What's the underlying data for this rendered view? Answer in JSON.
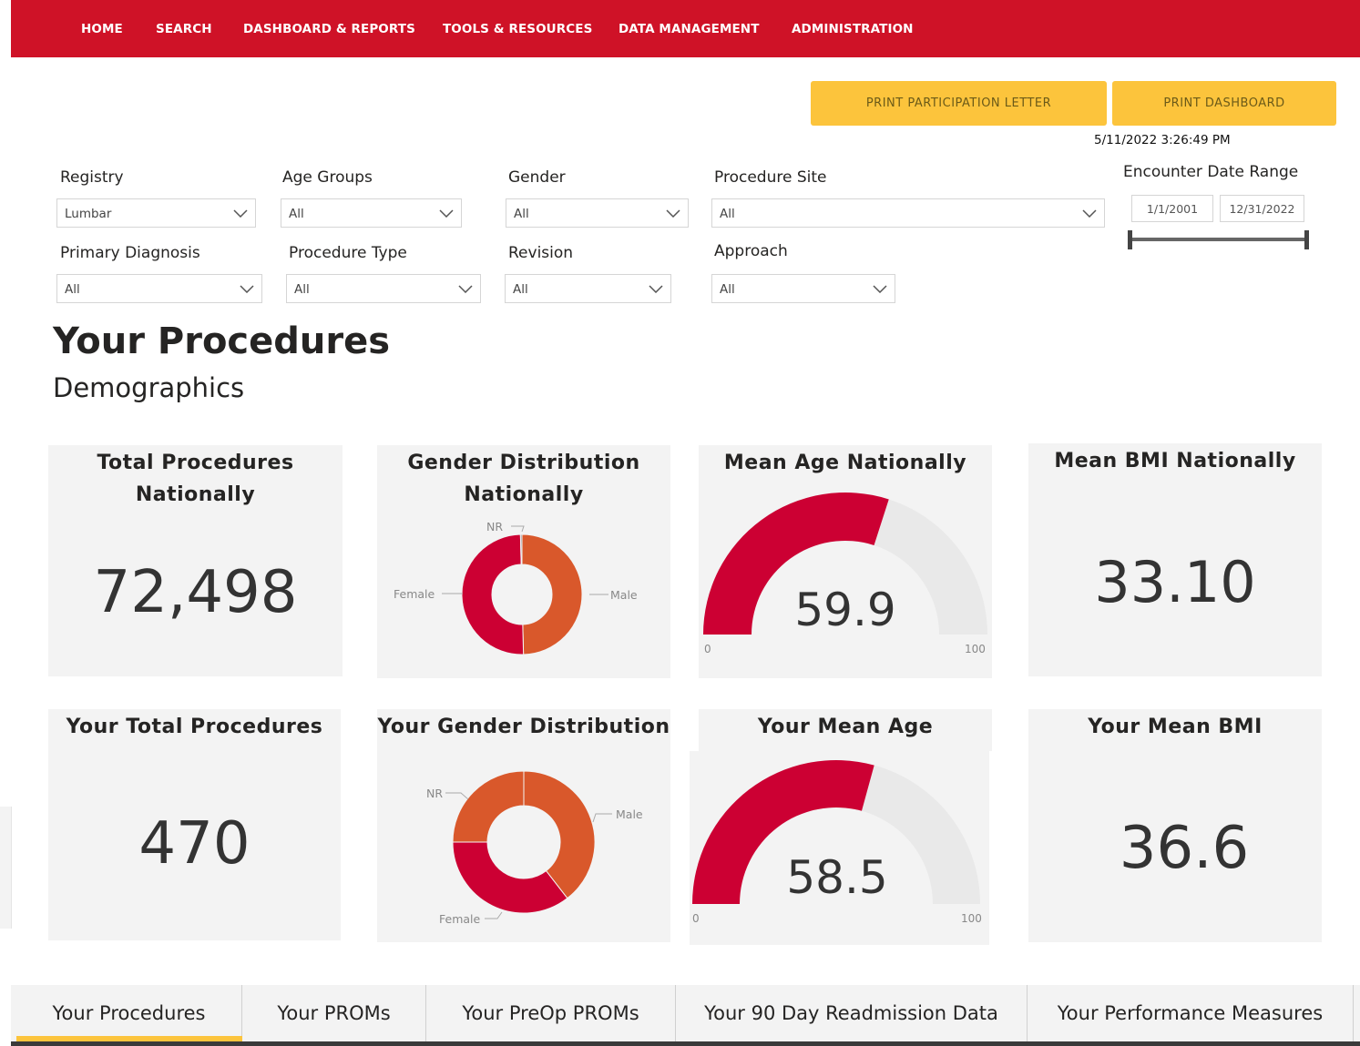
{
  "nav": {
    "items": [
      "HOME",
      "SEARCH",
      "DASHBOARD & REPORTS",
      "TOOLS & RESOURCES",
      "DATA MANAGEMENT",
      "ADMINISTRATION"
    ]
  },
  "actions": {
    "print_letter": "PRINT PARTICIPATION LETTER",
    "print_dashboard": "PRINT DASHBOARD",
    "timestamp": "5/11/2022 3:26:49 PM"
  },
  "filters": {
    "registry": {
      "label": "Registry",
      "value": "Lumbar"
    },
    "age_groups": {
      "label": "Age Groups",
      "value": "All"
    },
    "gender": {
      "label": "Gender",
      "value": "All"
    },
    "procedure_site": {
      "label": "Procedure Site",
      "value": "All"
    },
    "primary_diagnosis": {
      "label": "Primary Diagnosis",
      "value": "All"
    },
    "procedure_type": {
      "label": "Procedure Type",
      "value": "All"
    },
    "revision": {
      "label": "Revision",
      "value": "All"
    },
    "approach": {
      "label": "Approach",
      "value": "All"
    },
    "date_range": {
      "label": "Encounter Date Range",
      "start": "1/1/2001",
      "end": "12/31/2022"
    }
  },
  "heading": {
    "title": "Your Procedures",
    "subtitle": "Demographics"
  },
  "cards": {
    "total_national": {
      "title_1": "Total Procedures",
      "title_2": "Nationally",
      "value": "72,498"
    },
    "gender_national": {
      "title_1": "Gender Distribution",
      "title_2": "Nationally",
      "label_nr": "NR",
      "label_female": "Female",
      "label_male": "Male"
    },
    "age_national": {
      "title": "Mean Age Nationally",
      "value": "59.9",
      "min": "0",
      "max": "100"
    },
    "bmi_national": {
      "title": "Mean BMI Nationally",
      "value": "33.10"
    },
    "total_yours": {
      "title": "Your Total Procedures",
      "value": "470"
    },
    "gender_yours": {
      "title": "Your Gender Distribution",
      "label_nr": "NR",
      "label_female": "Female",
      "label_male": "Male"
    },
    "age_yours": {
      "title": "Your Mean Age",
      "value": "58.5",
      "min": "0",
      "max": "100"
    },
    "bmi_yours": {
      "title": "Your Mean BMI",
      "value": "36.6"
    }
  },
  "chart_data": [
    {
      "type": "pie",
      "categories": [
        "Male",
        "Female",
        "NR"
      ],
      "values": [
        49.6,
        50.0,
        0.4
      ],
      "colors": [
        "#d9582b",
        "#cc0033",
        "#888888"
      ]
    },
    {
      "type": "pie",
      "categories": [
        "Male",
        "Female",
        "NR"
      ],
      "values": [
        39.5,
        35.5,
        25.0
      ],
      "colors": [
        "#d9582b",
        "#cc0033",
        "#d9582b"
      ]
    },
    {
      "type": "gauge",
      "value": 59.9,
      "min": 0,
      "max": 100,
      "colors": [
        "#cc0033",
        "#e9e9e9"
      ]
    },
    {
      "type": "gauge",
      "value": 58.5,
      "min": 0,
      "max": 100,
      "colors": [
        "#cc0033",
        "#e9e9e9"
      ]
    }
  ],
  "tabs": [
    "Your Procedures",
    "Your PROMs",
    "Your PreOp PROMs",
    "Your 90 Day Readmission Data",
    "Your Performance Measures"
  ],
  "colors": {
    "nav": "#cf1227",
    "accent": "#fcc43c",
    "card_bg": "#f3f3f3",
    "female": "#cc0033",
    "male": "#d9582b"
  }
}
